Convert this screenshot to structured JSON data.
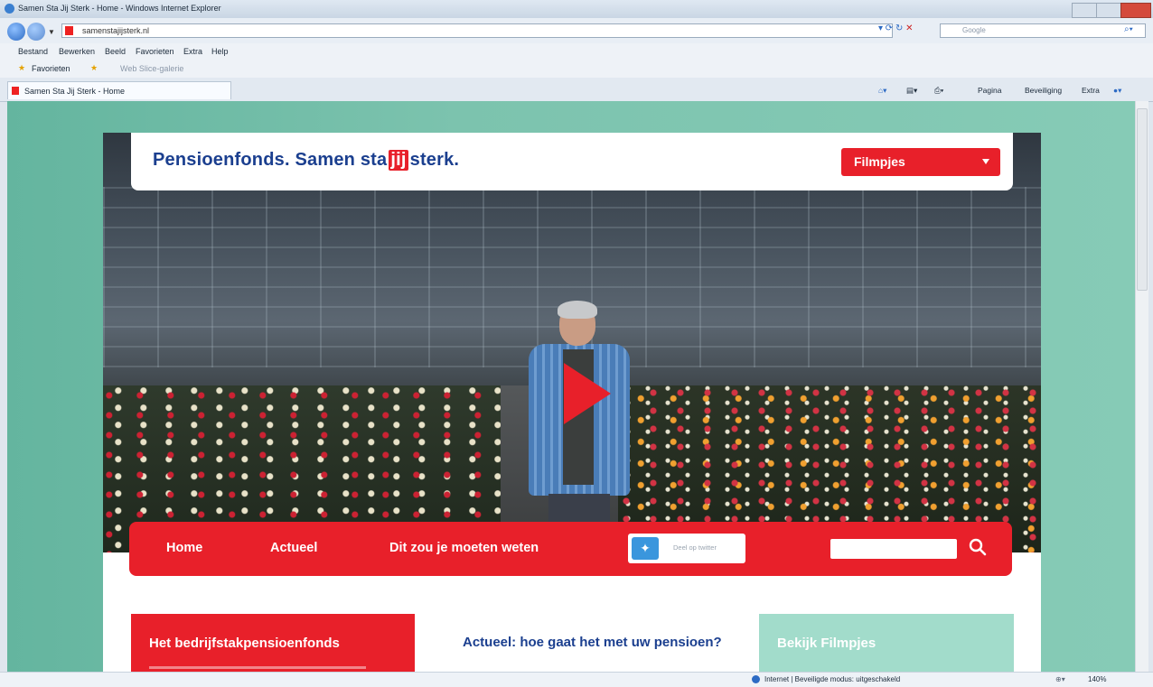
{
  "browser": {
    "window_title": "Samen Sta Jij Sterk - Home - Windows Internet Explorer",
    "url": "samenstajijsterk.nl",
    "search_placeholder": "Google",
    "menu": [
      "Bestand",
      "Bewerken",
      "Beeld",
      "Favorieten",
      "Extra",
      "Help"
    ],
    "favorites_label": "Favorieten",
    "web_slice_label": "Web Slice-galerie",
    "tab_title": "Samen Sta Jij Sterk - Home",
    "command_bar": [
      "Pagina",
      "Beveiliging",
      "Extra"
    ],
    "status_zone": "Internet | Beveiligde modus: uitgeschakeld",
    "zoom": "140%"
  },
  "site": {
    "logo_part1": "Pensioenfonds.",
    "logo_part2": "Samen sta",
    "logo_jij": "jij",
    "logo_part3": "sterk.",
    "dropdown_label": "Filmpjes",
    "nav": [
      "Home",
      "Actueel",
      "Dit zou je moeten weten"
    ],
    "share_label": "Deel op twitter",
    "block_red_title": "Het bedrijfstakpensioenfonds",
    "actueel_title": "Actueel: hoe gaat het met uw pensioen?",
    "block_green_title": "Bekijk Filmpjes"
  },
  "colors": {
    "brand_red": "#e8202a",
    "brand_blue": "#1b3f8f",
    "bg_green": "#7cc3ae"
  }
}
